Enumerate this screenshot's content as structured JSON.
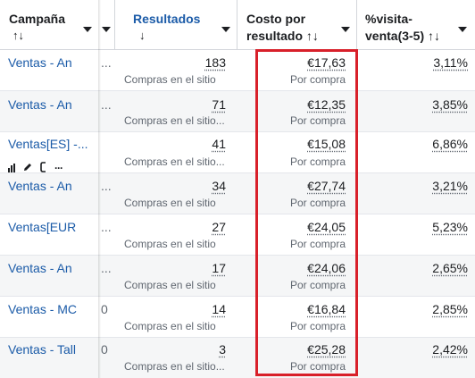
{
  "header": {
    "campaign": {
      "title": "Campaña",
      "sort": "↑↓"
    },
    "results": {
      "title": "Resultados",
      "sort": "↓"
    },
    "cost": {
      "title_line1": "Costo por",
      "title_line2": "resultado",
      "sort": "↑↓"
    },
    "visit": {
      "title_line1": "%visita-",
      "title_line2": "venta(3-5)",
      "sort": "↑↓"
    }
  },
  "rows": [
    {
      "campaign": "Ventas - An",
      "trunc": "...",
      "results": "183",
      "results_type": "Compras en el sitio",
      "cost": "€17,63",
      "cost_type": "Por compra",
      "visit_pct": "3,11%"
    },
    {
      "campaign": "Ventas - An",
      "trunc": "...",
      "results": "71",
      "results_type": "Compras en el sitio...",
      "cost": "€12,35",
      "cost_type": "Por compra",
      "visit_pct": "3,85%"
    },
    {
      "campaign": "Ventas[ES] -...",
      "trunc": "",
      "results": "41",
      "results_type": "Compras en el sitio...",
      "cost": "€15,08",
      "cost_type": "Por compra",
      "visit_pct": "6,86%"
    },
    {
      "campaign": "Ventas - An",
      "trunc": "...",
      "results": "34",
      "results_type": "Compras en el sitio",
      "cost": "€27,74",
      "cost_type": "Por compra",
      "visit_pct": "3,21%"
    },
    {
      "campaign": "Ventas[EUR",
      "trunc": "...",
      "results": "27",
      "results_type": "Compras en el sitio",
      "cost": "€24,05",
      "cost_type": "Por compra",
      "visit_pct": "5,23%"
    },
    {
      "campaign": "Ventas - An",
      "trunc": "...",
      "results": "17",
      "results_type": "Compras en el sitio",
      "cost": "€24,06",
      "cost_type": "Por compra",
      "visit_pct": "2,65%"
    },
    {
      "campaign": "Ventas - MC",
      "trunc": "0",
      "results": "14",
      "results_type": "Compras en el sitio",
      "cost": "€16,84",
      "cost_type": "Por compra",
      "visit_pct": "2,85%"
    },
    {
      "campaign": "Ventas - Tall",
      "trunc": "0",
      "results": "3",
      "results_type": "Compras en el sitio...",
      "cost": "€25,28",
      "cost_type": "Por compra",
      "visit_pct": "2,42%"
    }
  ],
  "row_actions": {
    "more": "···"
  },
  "colors": {
    "link": "#1b5ba8",
    "highlight": "#d8202a",
    "text": "#1c1e21",
    "muted": "#606770"
  }
}
